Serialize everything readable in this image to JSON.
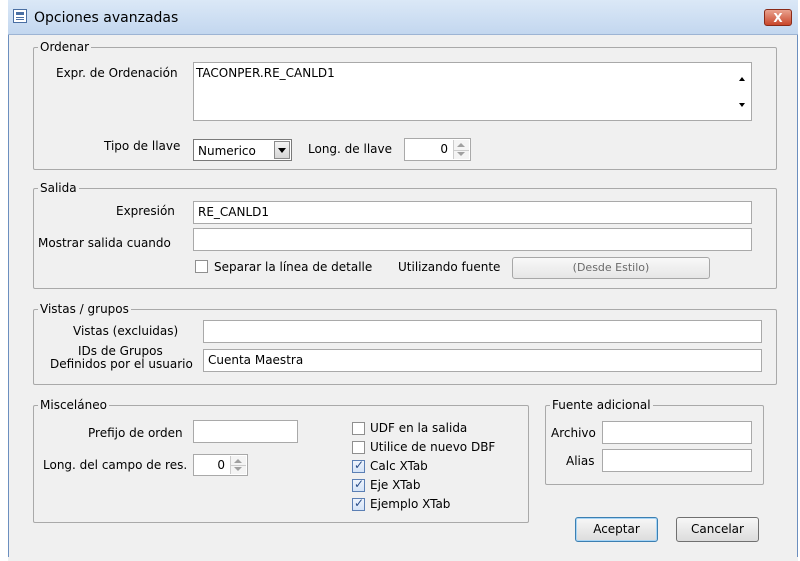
{
  "window": {
    "title": "Opciones avanzadas",
    "close_label": "X"
  },
  "ordenar": {
    "legend": "Ordenar",
    "expr_label": "Expr. de Ordenación",
    "expr_value": "TACONPER.RE_CANLD1",
    "tipo_label": "Tipo de llave",
    "tipo_value": "Numerico",
    "long_label": "Long. de llave",
    "long_value": "0"
  },
  "salida": {
    "legend": "Salida",
    "expresion_label": "Expresión",
    "expresion_value": "RE_CANLD1",
    "mostrar_label": "Mostrar salida cuando",
    "mostrar_value": "",
    "separar_label": "Separar la línea de detalle",
    "separar_checked": false,
    "fuente_label": "Utilizando fuente",
    "fuente_button": "(Desde Estilo)"
  },
  "vistas": {
    "legend": "Vistas / grupos",
    "excluidas_label": "Vistas (excluidas)",
    "excluidas_value": "",
    "ids_label_line1": "IDs de Grupos",
    "ids_label_line2": "Definidos por el usuario",
    "ids_value": "Cuenta Maestra"
  },
  "misc": {
    "legend": "Misceláneo",
    "prefijo_label": "Prefijo de orden",
    "prefijo_value": "",
    "longcampo_label": "Long. del campo de res.",
    "longcampo_value": "0",
    "checks": [
      {
        "label": "UDF en la salida",
        "checked": false
      },
      {
        "label": "Utilice de nuevo DBF",
        "checked": false
      },
      {
        "label": "Calc XTab",
        "checked": true
      },
      {
        "label": "Eje XTab",
        "checked": true
      },
      {
        "label": "Ejemplo XTab",
        "checked": true
      }
    ]
  },
  "fuente": {
    "legend": "Fuente adicional",
    "archivo_label": "Archivo",
    "archivo_value": "",
    "alias_label": "Alias",
    "alias_value": ""
  },
  "buttons": {
    "aceptar": "Aceptar",
    "cancelar": "Cancelar"
  },
  "colors": {
    "title_bar": "#c3d7ef",
    "dialog_bg": "#f0f0f0",
    "close_button": "#c9472b",
    "default_button_border": "#3c7fb1"
  },
  "icons": {
    "title": "window-app-icon",
    "check": "checkmark"
  }
}
